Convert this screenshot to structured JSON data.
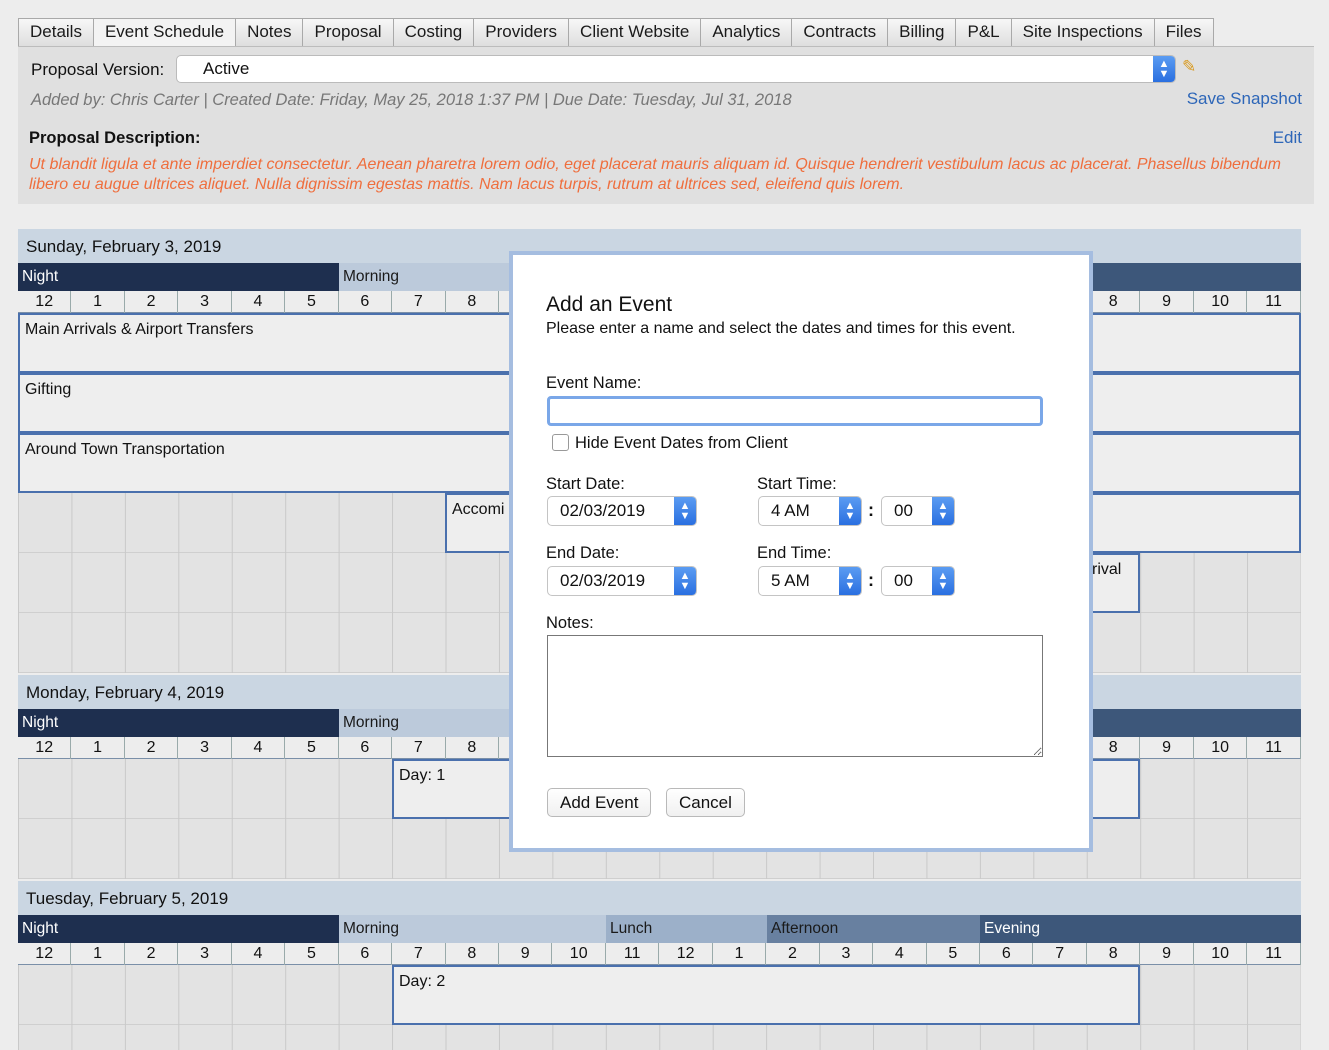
{
  "tabs": [
    "Details",
    "Event Schedule",
    "Notes",
    "Proposal",
    "Costing",
    "Providers",
    "Client Website",
    "Analytics",
    "Contracts",
    "Billing",
    "P&L",
    "Site Inspections",
    "Files"
  ],
  "proposal": {
    "version_label": "Proposal Version:",
    "version_value": "Active",
    "meta": "Added by: Chris Carter | Created Date: Friday, May 25, 2018 1:37 PM | Due Date: Tuesday, Jul 31, 2018",
    "save_snapshot": "Save Snapshot",
    "description_label": "Proposal Description:",
    "edit": "Edit",
    "description": "Ut blandit ligula et ante imperdiet consectetur. Aenean pharetra lorem odio, eget placerat mauris aliquam id. Quisque hendrerit vestibulum lacus ac placerat. Phasellus bibendum libero eu augue ultrices aliquet. Nulla dignissim egestas mattis. Nam lacus turpis, rutrum at ultrices sed, eleifend quis lorem."
  },
  "hours": [
    "12",
    "1",
    "2",
    "3",
    "4",
    "5",
    "6",
    "7",
    "8",
    "9",
    "10",
    "11",
    "12",
    "1",
    "2",
    "3",
    "4",
    "5",
    "6",
    "7",
    "8",
    "9",
    "10",
    "11"
  ],
  "days": [
    {
      "date": "Sunday, February 3, 2019",
      "bands": {
        "night": "Night",
        "morning": "Morning"
      }
    },
    {
      "date": "Monday, February 4, 2019",
      "bands": {
        "night": "Night",
        "morning": "Morning"
      }
    },
    {
      "date": "Tuesday, February 5, 2019",
      "bands": {
        "night": "Night",
        "morning": "Morning",
        "lunch": "Lunch",
        "afternoon": "Afternoon",
        "evening": "Evening"
      }
    }
  ],
  "events": {
    "main_arrivals": "Main Arrivals & Airport Transfers",
    "gifting": "Gifting",
    "around_town": "Around Town Transportation",
    "accom": "Accomi",
    "arrival": "rival",
    "day1": "Day: 1",
    "day2": "Day: 2"
  },
  "modal": {
    "title": "Add an Event",
    "subtitle": "Please enter a name and select the dates and times for this event.",
    "event_name_label": "Event Name:",
    "event_name_value": "",
    "hide_dates_label": "Hide Event Dates from Client",
    "start_date_label": "Start Date:",
    "start_date": "02/03/2019",
    "start_time_label": "Start Time:",
    "start_hour": "4 AM",
    "start_minute": "00",
    "end_date_label": "End Date:",
    "end_date": "02/03/2019",
    "end_time_label": "End Time:",
    "end_hour": "5 AM",
    "end_minute": "00",
    "notes_label": "Notes:",
    "add_button": "Add Event",
    "cancel_button": "Cancel"
  }
}
